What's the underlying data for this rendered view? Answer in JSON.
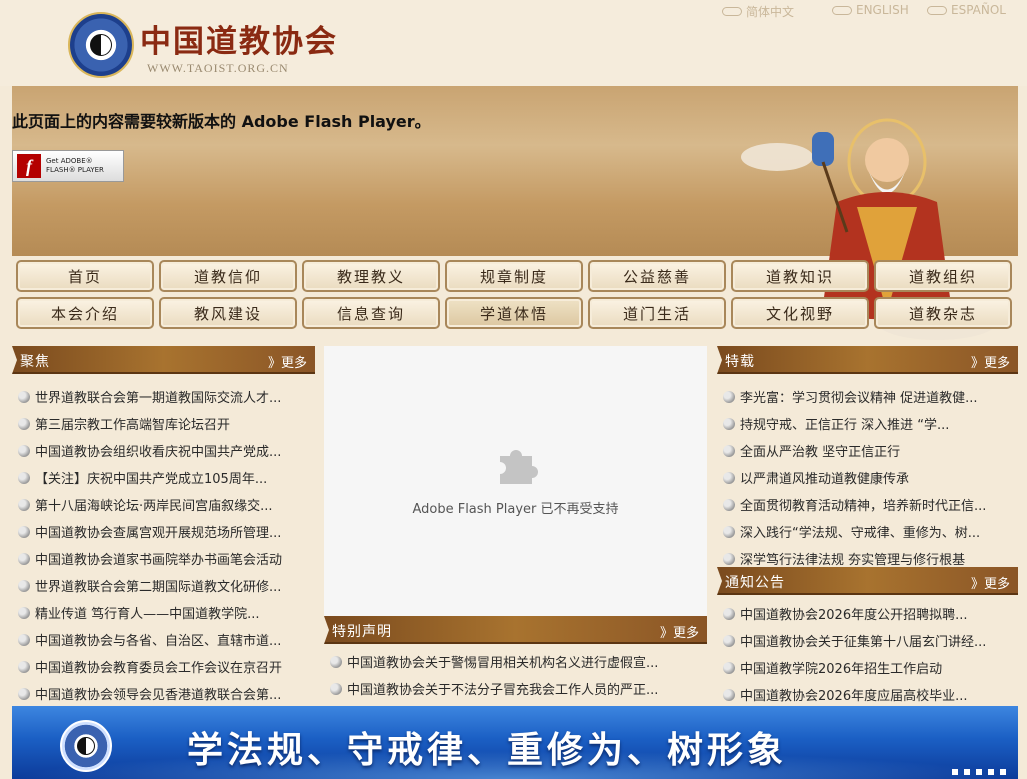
{
  "header": {
    "site_title": "中国道教协会",
    "site_url": "WWW.TAOIST.ORG.CN",
    "languages": [
      "简体中文",
      "ENGLISH",
      "ESPAÑOL"
    ]
  },
  "banner": {
    "flash_message": "此页面上的内容需要较新版本的 Adobe Flash Player。",
    "flash_badge_line1": "Get ADOBE®",
    "flash_badge_line2": "FLASH® PLAYER"
  },
  "nav": {
    "row1": [
      "首页",
      "道教信仰",
      "教理教义",
      "规章制度",
      "公益慈善",
      "道教知识",
      "道教组织"
    ],
    "row2": [
      "本会介绍",
      "教风建设",
      "信息查询",
      "学道体悟",
      "道门生活",
      "文化视野",
      "道教杂志"
    ]
  },
  "focus": {
    "title": "聚焦",
    "more": "》更多",
    "items": [
      "世界道教联合会第一期道教国际交流人才...",
      "第三届宗教工作高端智库论坛召开",
      "中国道教协会组织收看庆祝中国共产党成...",
      "【关注】庆祝中国共产党成立105周年...",
      "第十八届海峡论坛·两岸民间宫庙叙缘交...",
      "中国道教协会查属宫观开展规范场所管理...",
      "中国道教协会道家书画院举办书画笔会活动",
      "世界道教联合会第二期国际道教文化研修...",
      "精业传道  笃行育人——中国道教学院...",
      "中国道教协会与各省、自治区、直辖市道...",
      "中国道教协会教育委员会工作会议在京召开",
      "中国道教协会领导会见香港道教联合会第..."
    ]
  },
  "plugin": {
    "message": "Adobe Flash Player 已不再受支持"
  },
  "special": {
    "title": "特别声明",
    "more": "》更多",
    "items": [
      "中国道教协会关于警惕冒用相关机构名义进行虚假宣...",
      "中国道教协会关于不法分子冒充我会工作人员的严正..."
    ]
  },
  "feature": {
    "title": "特载",
    "more": "》更多",
    "items": [
      "李光富：学习贯彻会议精神 促进道教健...",
      "持规守戒、正信正行 深入推进 “学...",
      "全面从严治教 坚守正信正行",
      "以严肃道风推动道教健康传承",
      "全面贯彻教育活动精神，培养新时代正信...",
      "深入践行“学法规、守戒律、重修为、树...",
      "深学笃行法律法规 夯实管理与修行根基"
    ]
  },
  "notice": {
    "title": "通知公告",
    "more": "》更多",
    "items": [
      "中国道教协会2026年度公开招聘拟聘...",
      "中国道教协会关于征集第十八届玄门讲经...",
      "中国道教学院2026年招生工作启动",
      "中国道教协会2026年度应届高校毕业..."
    ]
  },
  "bottom_banner": {
    "slogan": "学法规、守戒律、重修为、树形象"
  }
}
